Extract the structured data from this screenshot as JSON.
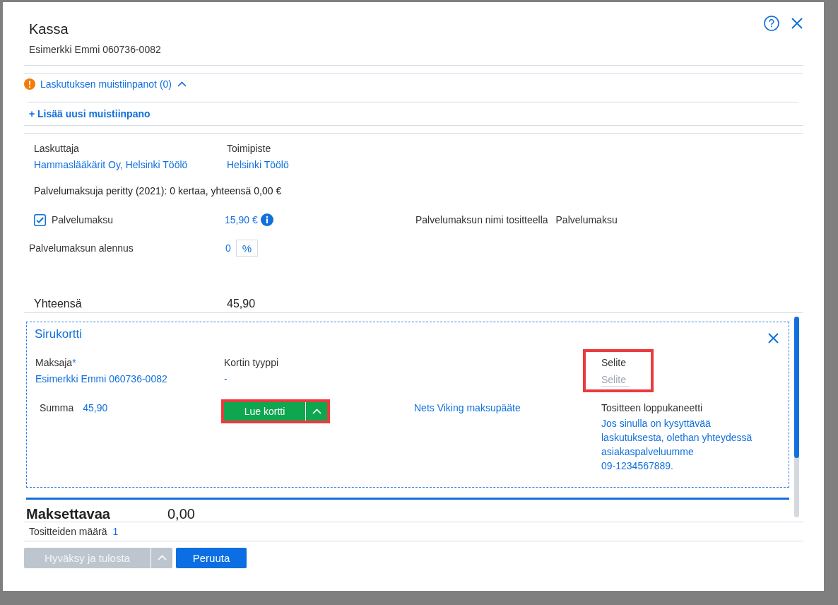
{
  "dialog": {
    "title": "Kassa",
    "subtitle": "Esimerkki Emmi 060736-0082"
  },
  "notes": {
    "label": "Laskutuksen muistiinpanot (0)",
    "expanded": true,
    "add_link": "+ Lisää uusi muistiinpano"
  },
  "billing": {
    "fields": [
      {
        "label": "Laskuttaja",
        "value": "Hammaslääkärit Oy, Helsinki Töölö"
      },
      {
        "label": "Toimipiste",
        "value": "Helsinki Töölö"
      }
    ],
    "summary": "Palvelumaksuja peritty (2021): 0 kertaa, yhteensä 0,00 €"
  },
  "service_fee": {
    "label": "Palvelumaksu",
    "checked": true,
    "amount": "15,90 €",
    "name_label": "Palvelumaksun nimi tositteella",
    "name_value": "Palvelumaksu",
    "discount_label": "Palvelumaksun alennus",
    "discount_value": "0",
    "discount_unit": "%"
  },
  "total": {
    "label": "Yhteensä",
    "value": "45,90"
  },
  "payment": {
    "title": "Sirukortti",
    "payer": {
      "label": "Maksaja",
      "required_mark": "*",
      "value": "Esimerkki Emmi 060736-0082"
    },
    "card_type": {
      "label": "Kortin tyyppi",
      "value": "-"
    },
    "description": {
      "label": "Selite",
      "placeholder": "Selite",
      "highlighted": true
    },
    "sum": {
      "label": "Summa",
      "value": "45,90"
    },
    "read_button": {
      "label": "Lue kortti",
      "highlighted": true
    },
    "terminal": "Nets Viking maksupääte",
    "receipt_note": {
      "label": "Tositteen loppukaneetti",
      "text": "Jos sinulla on kysyttävää laskutuksesta, olethan yhteydessä asiakaspalveluumme 09-1234567889."
    }
  },
  "amount_due": {
    "label": "Maksettavaa",
    "value": "0,00"
  },
  "receipts": {
    "label": "Tositteiden määrä",
    "value": "1"
  },
  "buttons": [
    {
      "label": "Hyväksy ja tulosta",
      "kind": "split",
      "disabled": true
    },
    {
      "label": "Peruuta",
      "kind": "plain",
      "disabled": false
    }
  ]
}
